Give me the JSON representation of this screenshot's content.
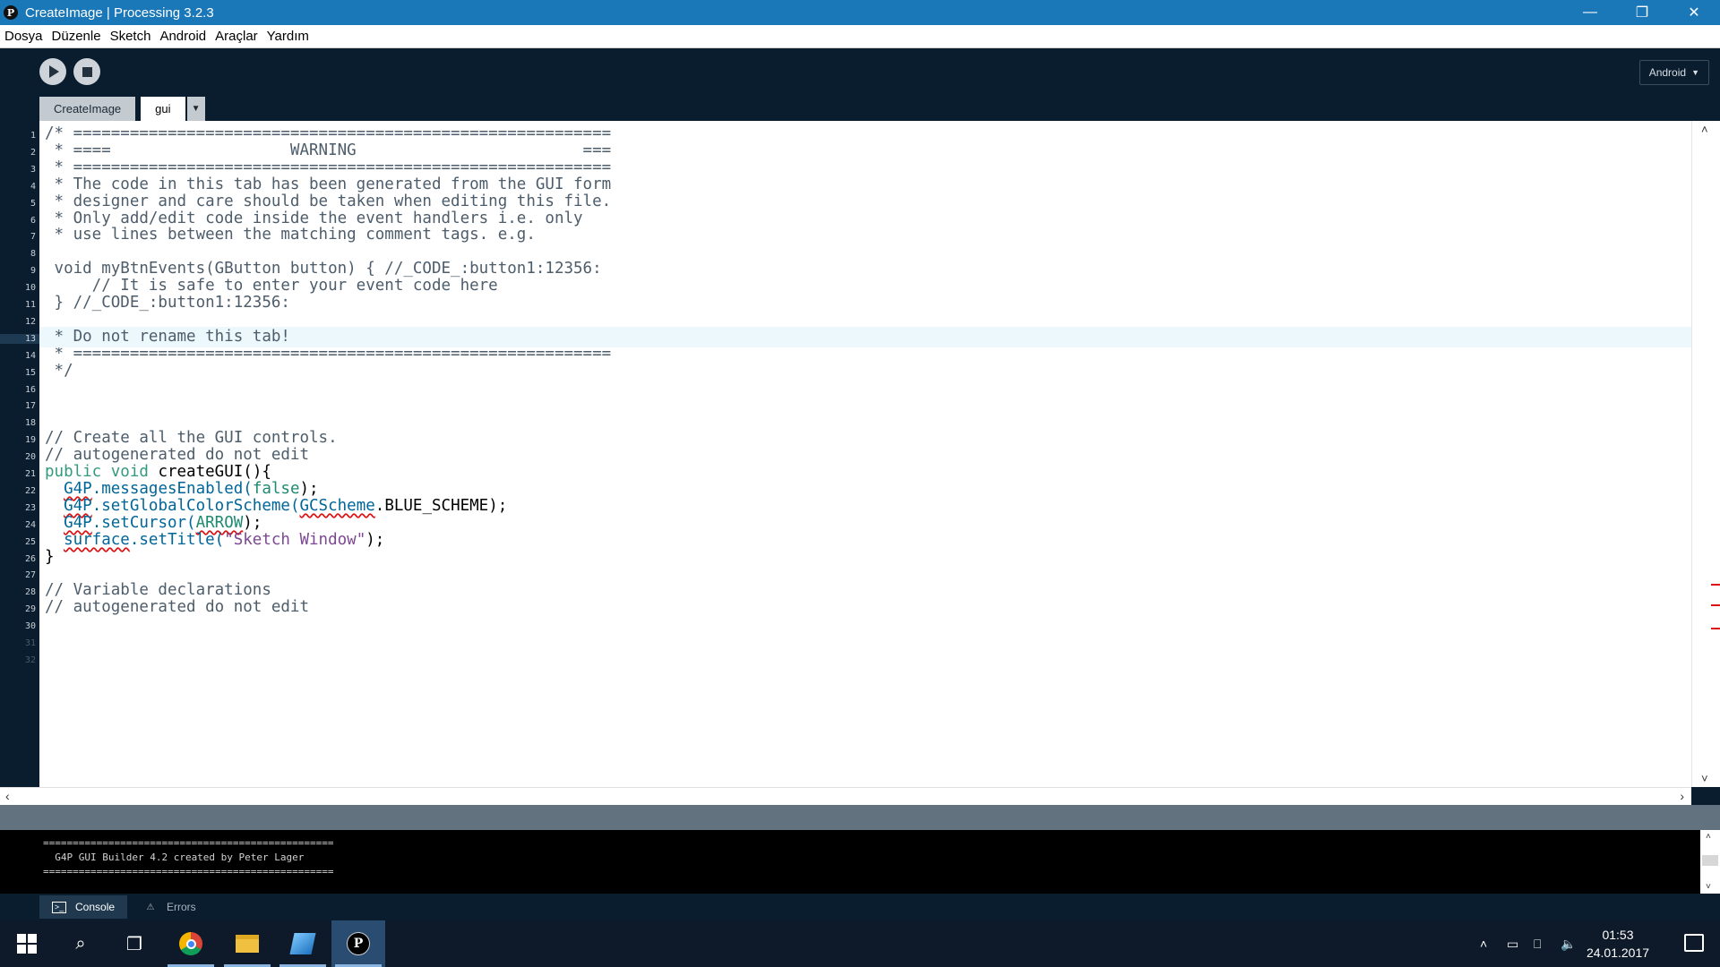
{
  "window": {
    "title": "CreateImage | Processing 3.2.3",
    "app_icon": "P"
  },
  "menu": [
    "Dosya",
    "Düzenle",
    "Sketch",
    "Android",
    "Araçlar",
    "Yardım"
  ],
  "toolbar": {
    "mode_label": "Android",
    "mode_caret": "▼"
  },
  "tabs": [
    {
      "label": "CreateImage",
      "active": false
    },
    {
      "label": "gui",
      "active": true
    }
  ],
  "tab_menu_arrow": "▼",
  "editor": {
    "current_line": 13,
    "line_numbers": [
      "1",
      "2",
      "3",
      "4",
      "5",
      "6",
      "7",
      "8",
      "9",
      "10",
      "11",
      "12",
      "13",
      "14",
      "15",
      "16",
      "17",
      "18",
      "19",
      "20",
      "21",
      "22",
      "23",
      "24",
      "25",
      "26",
      "27",
      "28",
      "29",
      "30",
      "31",
      "32"
    ],
    "lines": [
      "/* =========================================================",
      " * ====                   WARNING                        ===",
      " * =========================================================",
      " * The code in this tab has been generated from the GUI form",
      " * designer and care should be taken when editing this file.",
      " * Only add/edit code inside the event handlers i.e. only",
      " * use lines between the matching comment tags. e.g.",
      "",
      " void myBtnEvents(GButton button) { //_CODE_:button1:12356:",
      "     // It is safe to enter your event code here",
      " } //_CODE_:button1:12356:",
      "",
      " * Do not rename this tab!",
      " * =========================================================",
      " */",
      "",
      "",
      "",
      "// Create all the GUI controls.",
      "// autogenerated do not edit",
      "",
      "",
      "",
      "",
      "",
      "}",
      "",
      "// Variable declarations",
      "// autogenerated do not edit"
    ],
    "l21": {
      "kw": "public void",
      "fn": "createGUI",
      "rest": "(){"
    },
    "l22": {
      "indent": "  ",
      "cls": "G4P",
      "mid": ".messagesEnabled(",
      "arg": "false",
      "end": ");"
    },
    "l23": {
      "indent": "  ",
      "cls": "G4P",
      "mid": ".setGlobalColorScheme(",
      "arg": "GCScheme",
      "end": ".BLUE_SCHEME);"
    },
    "l24": {
      "indent": "  ",
      "cls": "G4P",
      "mid": ".setCursor(",
      "arg": "ARROW",
      "end": ");"
    },
    "l25": {
      "indent": "  ",
      "cls": "surface",
      "mid": ".setTitle(",
      "arg": "\"Sketch Window\"",
      "end": ");"
    }
  },
  "console": {
    "lines": [
      "=================================================",
      "  G4P GUI Builder 4.2 created by Peter Lager",
      "================================================="
    ]
  },
  "console_tabs": {
    "console": "Console",
    "errors": "Errors"
  },
  "taskbar": {
    "time": "01:53",
    "date": "24.01.2017"
  },
  "colors": {
    "title_bar": "#1a77b8",
    "editor_bg": "#0a1d2e",
    "comment": "#4d5d6b",
    "keyword": "#33997e",
    "error_underline": "#dd1111"
  }
}
